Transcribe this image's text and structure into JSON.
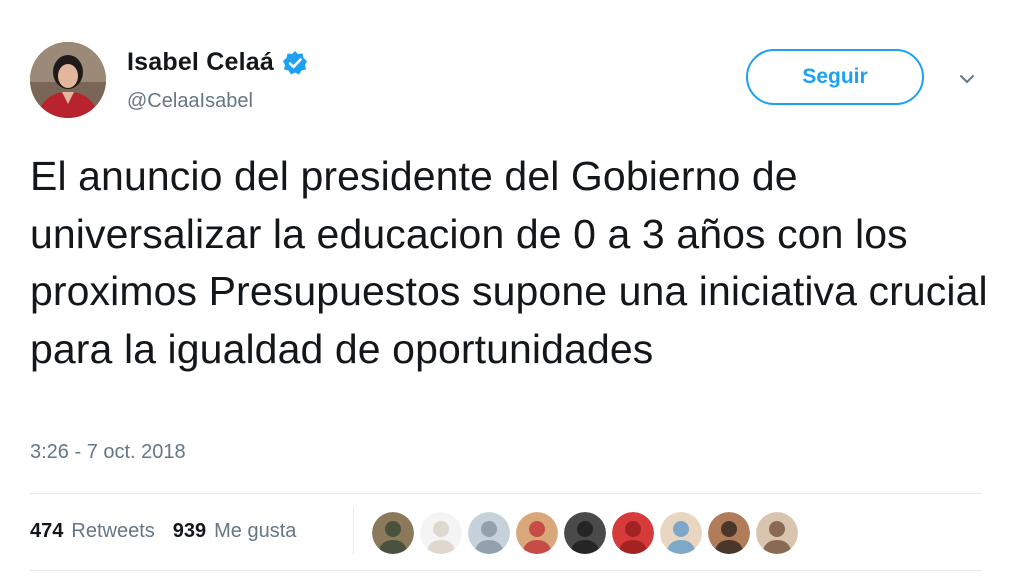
{
  "author": {
    "display_name": "Isabel Celaá",
    "handle": "@CelaaIsabel",
    "verified": true
  },
  "actions": {
    "follow_label": "Seguir"
  },
  "tweet": {
    "text": "El anuncio del presidente del Gobierno de universalizar la educacion de 0 a 3 años con los proximos Presupuestos supone una iniciativa crucial para la igualdad de oportunidades",
    "timestamp": "3:26 - 7 oct. 2018"
  },
  "stats": {
    "retweets_count": "474",
    "retweets_label": "Retweets",
    "likes_count": "939",
    "likes_label": "Me gusta"
  },
  "colors": {
    "accent": "#1da1f2",
    "text_primary": "#14171a",
    "text_secondary": "#657786",
    "divider": "#e6ecf0"
  },
  "icons": {
    "verified": "verified-badge-icon",
    "caret": "chevron-down-icon"
  },
  "likers": [
    {
      "name": "liker-avatar-1",
      "colors": [
        "#8a7a5a",
        "#3e4a3a"
      ]
    },
    {
      "name": "liker-avatar-2",
      "colors": [
        "#f4f4f4",
        "#d9d2c8"
      ]
    },
    {
      "name": "liker-avatar-3",
      "colors": [
        "#c7d1d9",
        "#8899a6"
      ]
    },
    {
      "name": "liker-avatar-4",
      "colors": [
        "#d9a87a",
        "#c23c3c"
      ]
    },
    {
      "name": "liker-avatar-5",
      "colors": [
        "#4a4a4a",
        "#1e1e1e"
      ]
    },
    {
      "name": "liker-avatar-6",
      "colors": [
        "#d63a3a",
        "#9a1e1e"
      ]
    },
    {
      "name": "liker-avatar-7",
      "colors": [
        "#e8d6c0",
        "#6aa0c8"
      ]
    },
    {
      "name": "liker-avatar-8",
      "colors": [
        "#b07c5a",
        "#3a2a22"
      ]
    },
    {
      "name": "liker-avatar-9",
      "colors": [
        "#d9c4b0",
        "#7a5a44"
      ]
    }
  ]
}
